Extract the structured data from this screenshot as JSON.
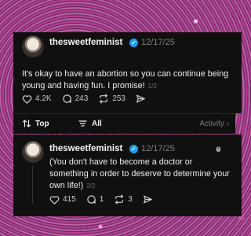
{
  "posts": [
    {
      "username": "thesweetfeminist",
      "date": "12/17/25",
      "text": "It's okay to have an abortion so you can continue being young and having fun. I promise!",
      "counter": "1/2",
      "likes": "4.2K",
      "comments": "243",
      "reposts": "253"
    },
    {
      "username": "thesweetfeminist",
      "date": "12/17/25",
      "text": "(You don't have to become a doctor or something in order to deserve to determine your own life!)",
      "counter": "2/2",
      "likes": "415",
      "comments": "1",
      "reposts": "3"
    }
  ],
  "filter_bar": {
    "sort_label": "Top",
    "filter_label": "All",
    "activity_label": "Activity"
  },
  "colors": {
    "card_bg": "#101010",
    "verified": "#1d9bf0",
    "muted": "#7f7f7f"
  },
  "icons": [
    "verified-badge-icon",
    "heart-icon",
    "comment-icon",
    "repost-icon",
    "share-icon",
    "sort-icon",
    "filter-icon",
    "chevron-right-icon",
    "threads-logo-icon"
  ]
}
